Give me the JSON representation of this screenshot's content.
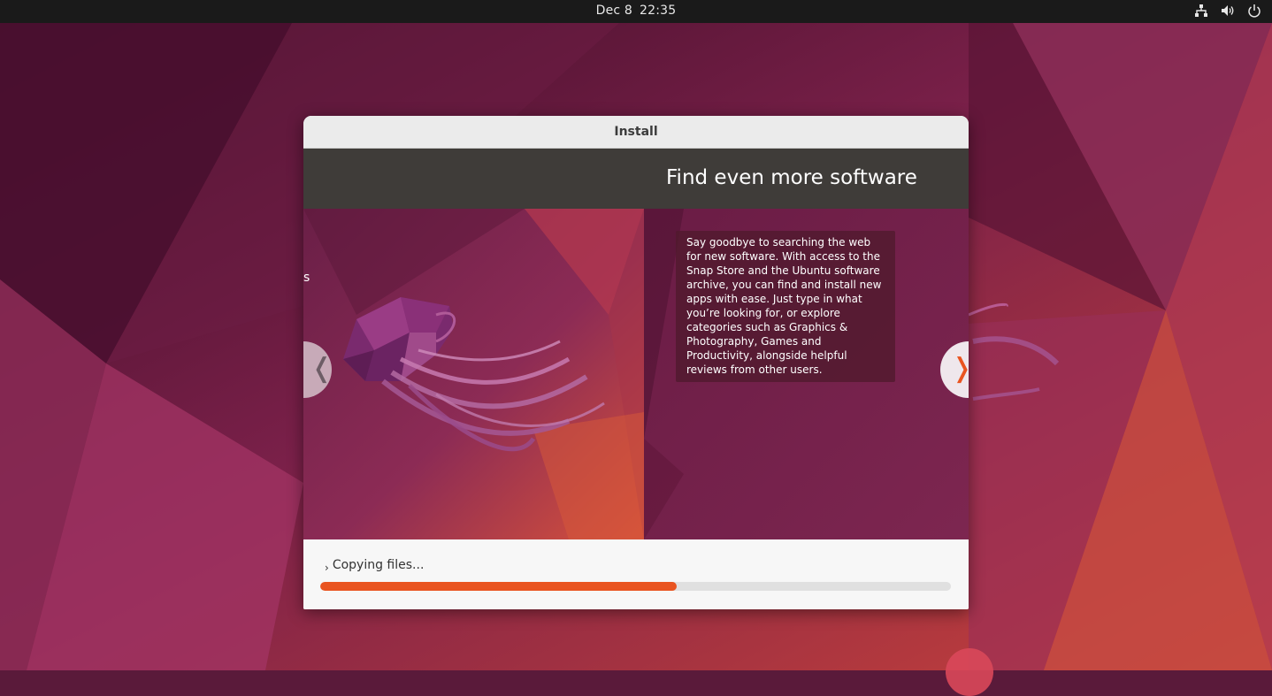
{
  "topbar": {
    "date": "Dec 8",
    "time": "22:35",
    "icons": [
      "network-icon",
      "volume-icon",
      "power-icon"
    ]
  },
  "window": {
    "title": "Install",
    "slide": {
      "title": "Find even more software",
      "description": "Say goodbye to searching the web for new software. With access to the Snap Store and the Ubuntu software archive, you can find and install new apps with ease. Just type in what you’re looking for, or explore categories such as Graphics & Photography, Games and Productivity, alongside helpful reviews from other users.",
      "stray_text": "s",
      "prev_label": "❬",
      "next_label": "❭"
    },
    "status": {
      "expander_arrow": "›",
      "label": "Copying files...",
      "progress": 0.565
    }
  },
  "colors": {
    "accent": "#e95420",
    "topbar": "#1a1a1a",
    "slide_header": "#3f3c39"
  }
}
